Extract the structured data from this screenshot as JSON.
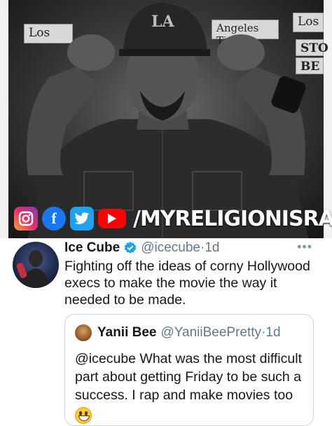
{
  "photo": {
    "cap_logo": "LA",
    "newspapers": [
      "Los",
      "Angeles Times",
      "Los",
      "STO",
      "BE"
    ]
  },
  "social_bar": {
    "icons": [
      "instagram-icon",
      "facebook-icon",
      "twitter-icon",
      "youtube-icon"
    ],
    "facebook_letter": "f",
    "handle": "/MYRELIGIONISRAP"
  },
  "tweet": {
    "author_name": "Ice Cube",
    "author_handle": "@icecube",
    "separator": " · ",
    "time": "1d",
    "text": "Fighting off the ideas of corny Hollywood execs to make the movie the way it needed to be made.",
    "more_icon": "•••",
    "quoted": {
      "author_name": "Yanii Bee",
      "author_handle": "@YaniiBeePretty",
      "separator": " · ",
      "time": "1d",
      "text": "@icecube What was the most difficult part about getting Friday to be such a success. I rap and make movies too",
      "emoji": "grinning-face"
    }
  },
  "colors": {
    "verified_blue": "#1da1f2",
    "secondary_text": "#657786",
    "primary_text": "#14171a"
  }
}
